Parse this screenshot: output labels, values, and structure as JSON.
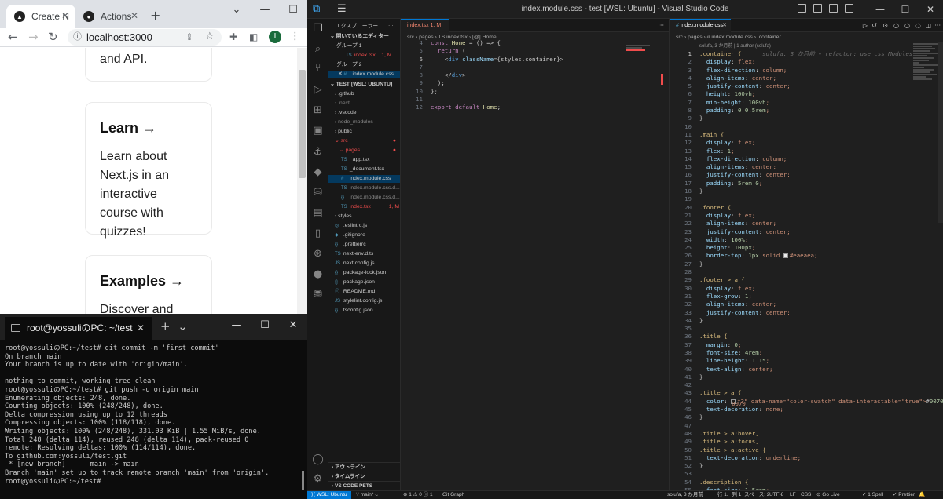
{
  "chrome": {
    "tabs": [
      {
        "label": "Create N",
        "favicon": "next-logo-icon"
      },
      {
        "label": "Actions",
        "favicon": "github-icon"
      }
    ],
    "new_tab": "+",
    "url": "localhost:3000",
    "avatar_letter": "I",
    "page": {
      "card0_text": "and API.",
      "card1_title": "Learn →",
      "card1_text": "Learn about Next.js in an interactive course with quizzes!",
      "card2_title": "Examples →",
      "card2_text": "Discover and"
    }
  },
  "terminal": {
    "tab_title": "root@yossuliのPC: ~/test",
    "lines": [
      "root@yossuliのPC:~/test# git commit -m 'first commit'",
      "On branch main",
      "Your branch is up to date with 'origin/main'.",
      "",
      "nothing to commit, working tree clean",
      "root@yossuliのPC:~/test# git push -u origin main",
      "Enumerating objects: 248, done.",
      "Counting objects: 100% (248/248), done.",
      "Delta compression using up to 12 threads",
      "Compressing objects: 100% (118/118), done.",
      "Writing objects: 100% (248/248), 331.03 KiB | 1.55 MiB/s, done.",
      "Total 248 (delta 114), reused 248 (delta 114), pack-reused 0",
      "remote: Resolving deltas: 100% (114/114), done.",
      "To github.com:yossuli/test.git",
      " * [new branch]      main -> main",
      "Branch 'main' set up to track remote branch 'main' from 'origin'.",
      "root@yossuliのPC:~/test#"
    ]
  },
  "vscode": {
    "title": "index.module.css - test [WSL: Ubuntu] - Visual Studio Code",
    "explorer": {
      "header": "エクスプローラー",
      "open_editors": "開いているエディター",
      "group1": "グループ 1",
      "group1_file": "index.tsx...",
      "group1_file_badge": "1, M",
      "group2": "グループ 2",
      "group2_file": "index.module.css...",
      "root": "TEST [WSL: UBUNTU]",
      "items": [
        ".github",
        ".next",
        ".vscode",
        "node_modules",
        "public",
        "src",
        "pages",
        "_app.tsx",
        "_document.tsx",
        "index.module.css",
        "index.module.css.d...",
        "index.module.css.d...",
        "index.tsx",
        "styles",
        ".eslintrc.js",
        ".gitignore",
        ".prettierrc",
        "next-env.d.ts",
        "next.config.js",
        "package-lock.json",
        "package.json",
        "README.md",
        "stylelint.config.js",
        "tsconfig.json"
      ],
      "index_badge": "1, M",
      "outline": "アウトライン",
      "timeline": "タイムライン",
      "code_pets": "VS CODE PETS"
    },
    "editor1": {
      "tab": "index.tsx",
      "tab_badge": "1, M",
      "breadcrumb": "src › pages › TS index.tsx › [@] Home",
      "lines": [
        {
          "n": "4",
          "text": "const Home = () => {"
        },
        {
          "n": "5",
          "text": "  return ("
        },
        {
          "n": "6",
          "text": "    <div className={styles.container}>"
        },
        {
          "n": "7",
          "text": ""
        },
        {
          "n": "8",
          "text": "    </div>"
        },
        {
          "n": "9",
          "text": "  );"
        },
        {
          "n": "10",
          "text": "};"
        },
        {
          "n": "11",
          "text": ""
        },
        {
          "n": "12",
          "text": "export default Home;"
        }
      ]
    },
    "editor2": {
      "tab": "index.module.css",
      "breadcrumb": "src › pages › # index.module.css › .container",
      "codelens": "solufa, 3 か月前 | 1 author (solufa)",
      "blame": "solufa, 3 か月前 • refactor: use css Modules",
      "lines": [
        {
          "n": "1",
          "text": ".container {"
        },
        {
          "n": "2",
          "text": "  display: flex;"
        },
        {
          "n": "3",
          "text": "  flex-direction: column;"
        },
        {
          "n": "4",
          "text": "  align-items: center;"
        },
        {
          "n": "5",
          "text": "  justify-content: center;"
        },
        {
          "n": "6",
          "text": "  height: 100vh;"
        },
        {
          "n": "7",
          "text": "  min-height: 100vh;"
        },
        {
          "n": "8",
          "text": "  padding: 0 0.5rem;"
        },
        {
          "n": "9",
          "text": "}"
        },
        {
          "n": "10",
          "text": ""
        },
        {
          "n": "11",
          "text": ".main {"
        },
        {
          "n": "12",
          "text": "  display: flex;"
        },
        {
          "n": "13",
          "text": "  flex: 1;"
        },
        {
          "n": "14",
          "text": "  flex-direction: column;"
        },
        {
          "n": "15",
          "text": "  align-items: center;"
        },
        {
          "n": "16",
          "text": "  justify-content: center;"
        },
        {
          "n": "17",
          "text": "  padding: 5rem 0;"
        },
        {
          "n": "18",
          "text": "}"
        },
        {
          "n": "19",
          "text": ""
        },
        {
          "n": "20",
          "text": ".footer {"
        },
        {
          "n": "21",
          "text": "  display: flex;"
        },
        {
          "n": "22",
          "text": "  align-items: center;"
        },
        {
          "n": "23",
          "text": "  justify-content: center;"
        },
        {
          "n": "24",
          "text": "  width: 100%;"
        },
        {
          "n": "25",
          "text": "  height: 100px;"
        },
        {
          "n": "26",
          "text": "  border-top: 1px solid #eaeaea;"
        },
        {
          "n": "27",
          "text": "}"
        },
        {
          "n": "28",
          "text": ""
        },
        {
          "n": "29",
          "text": ".footer > a {"
        },
        {
          "n": "30",
          "text": "  display: flex;"
        },
        {
          "n": "31",
          "text": "  flex-grow: 1;"
        },
        {
          "n": "32",
          "text": "  align-items: center;"
        },
        {
          "n": "33",
          "text": "  justify-content: center;"
        },
        {
          "n": "34",
          "text": "}"
        },
        {
          "n": "35",
          "text": ""
        },
        {
          "n": "36",
          "text": ".title {"
        },
        {
          "n": "37",
          "text": "  margin: 0;"
        },
        {
          "n": "38",
          "text": "  font-size: 4rem;"
        },
        {
          "n": "39",
          "text": "  line-height: 1.15;"
        },
        {
          "n": "40",
          "text": "  text-align: center;"
        },
        {
          "n": "41",
          "text": "}"
        },
        {
          "n": "42",
          "text": ""
        },
        {
          "n": "43",
          "text": ".title > a {"
        },
        {
          "n": "44",
          "text": "  color: #0070f3;"
        },
        {
          "n": "45",
          "text": "  text-decoration: none;"
        },
        {
          "n": "46",
          "text": "}"
        },
        {
          "n": "47",
          "text": ""
        },
        {
          "n": "48",
          "text": ".title > a:hover,"
        },
        {
          "n": "49",
          "text": ".title > a:focus,"
        },
        {
          "n": "50",
          "text": ".title > a:active {"
        },
        {
          "n": "51",
          "text": "  text-decoration: underline;"
        },
        {
          "n": "52",
          "text": "}"
        },
        {
          "n": "53",
          "text": ""
        },
        {
          "n": "54",
          "text": ".description {"
        },
        {
          "n": "55",
          "text": "  font-size: 1.5rem;"
        }
      ]
    },
    "status": {
      "remote": "WSL: Ubuntu",
      "branch": "main*",
      "problems": "⊗ 1 ⚠ 0 ⓘ 1",
      "git_graph": "Git Graph",
      "blame": "solufa, 3 か月前",
      "position": "行 1、列 1",
      "spaces": "スペース: 2",
      "encoding": "UTF-8",
      "eol": "LF",
      "lang": "CSS",
      "golive": "Go Live",
      "spell": "1 Spell",
      "prettier": "Prettier"
    },
    "colors": {
      "accent": "#0078d4",
      "bg": "#1e1e1e"
    }
  }
}
